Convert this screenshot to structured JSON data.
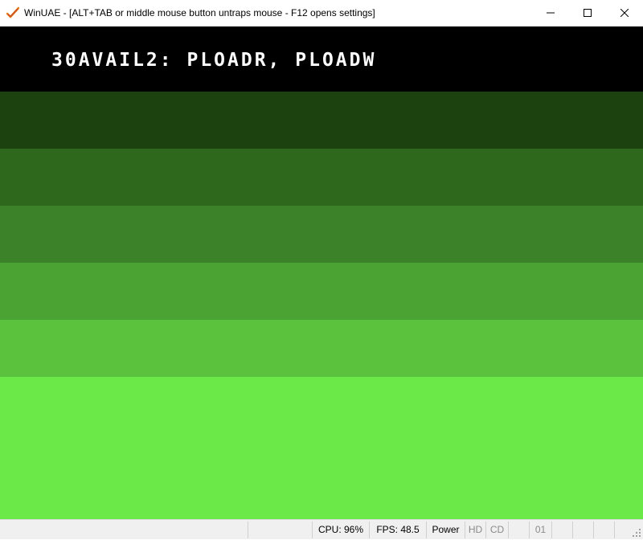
{
  "window": {
    "title": "WinUAE - [ALT+TAB or middle mouse button untraps mouse - F12 opens settings]",
    "app_icon": "winuae-checkmark-icon",
    "controls": {
      "minimize_icon": "minimize-icon",
      "maximize_icon": "maximize-icon",
      "close_icon": "close-icon"
    }
  },
  "screen": {
    "text": "30AVAIL2: PLOADR, PLOADW",
    "text_color": "#ffffff",
    "bands": [
      "#000000",
      "#1c420f",
      "#2d681d",
      "#3b8228",
      "#4aa332",
      "#5ac23d",
      "#6ae948"
    ]
  },
  "statusbar": {
    "cpu": "CPU: 96%",
    "fps": "FPS: 48.5",
    "power": "Power",
    "hd": "HD",
    "cd": "CD",
    "drive_1": "01",
    "resize_icon": "resize-grip-icon"
  }
}
